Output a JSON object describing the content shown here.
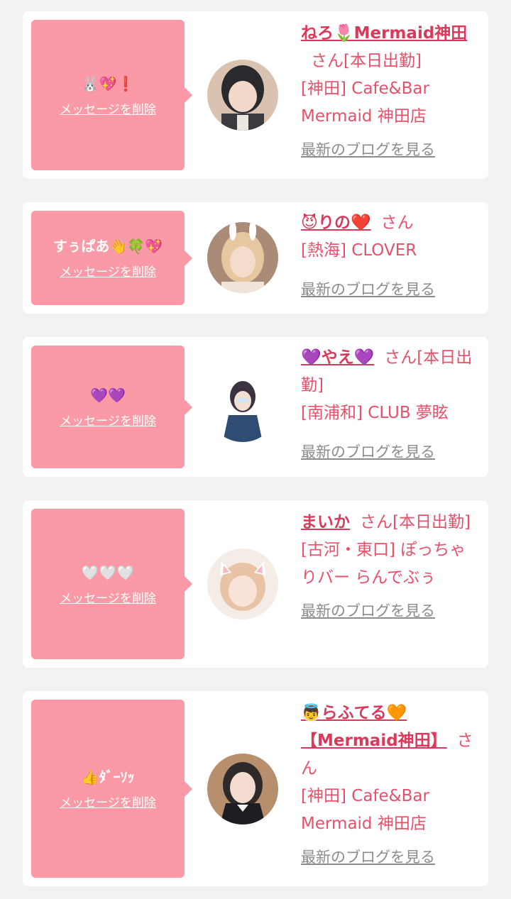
{
  "cards": [
    {
      "message": "🐰💖❗",
      "delete_label": "メッセージを削除",
      "name": "ねろ🌷Mermaid神田",
      "san": "さん",
      "status": "[本日出勤]",
      "location": "[神田] Cafe&Bar Mermaid 神田店",
      "blog_link": "最新のブログを見る"
    },
    {
      "message": "すぅぱあ👋🍀💖",
      "delete_label": "メッセージを削除",
      "name": "😈りの❤️",
      "san": "さん",
      "status": "",
      "location": "[熱海] CLOVER",
      "blog_link": "最新のブログを見る"
    },
    {
      "message": "💜💜",
      "delete_label": "メッセージを削除",
      "name": "💜やえ💜",
      "san": "さん",
      "status": "[本日出勤]",
      "location": "[南浦和] CLUB 夢眩",
      "blog_link": "最新のブログを見る"
    },
    {
      "message": "🤍🤍🤍",
      "delete_label": "メッセージを削除",
      "name": "まいか",
      "san": "さん",
      "status": "[本日出勤]",
      "location": "[古河・東口] ぽっちゃりバー らんでぶぅ",
      "blog_link": "最新のブログを見る"
    },
    {
      "message": "👍ﾀﾞｰｿｯ",
      "delete_label": "メッセージを削除",
      "name": "👼らふてる🧡【Mermaid神田】",
      "san": "さん",
      "status": "",
      "location": "[神田] Cafe&Bar Mermaid 神田店",
      "blog_link": "最新のブログを見る"
    }
  ]
}
